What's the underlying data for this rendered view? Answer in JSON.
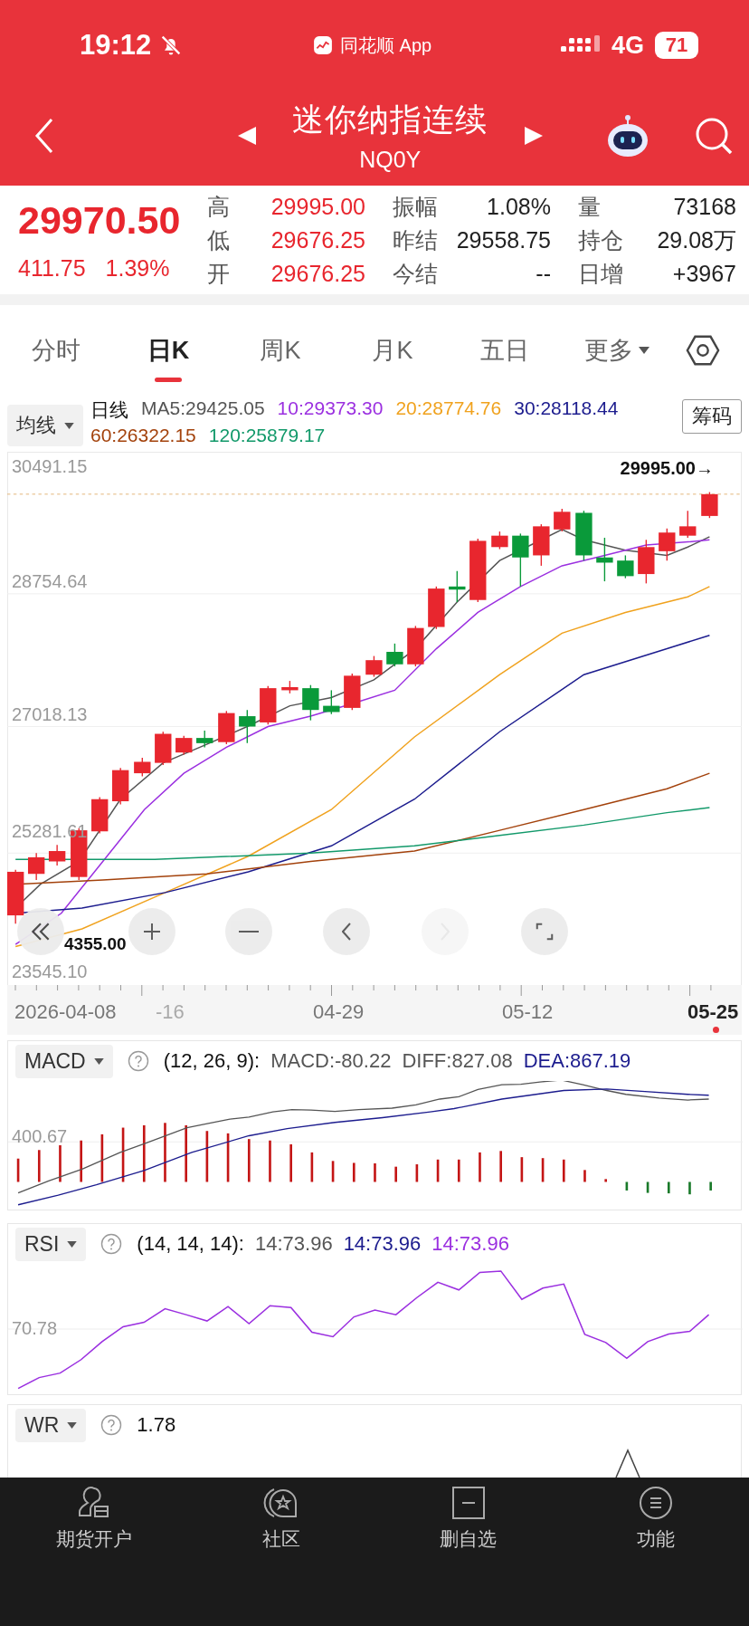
{
  "status_bar": {
    "time": "19:12",
    "app": "同花顺 App",
    "network": "4G",
    "battery": "71"
  },
  "header": {
    "title": "迷你纳指连续",
    "code": "NQ0Y"
  },
  "quote": {
    "price": "29970.50",
    "change": "411.75",
    "change_pct": "1.39%",
    "color": "#e8262e"
  },
  "stats": [
    {
      "label": "高",
      "value": "29995.00",
      "color": "#e8262e"
    },
    {
      "label": "振幅",
      "value": "1.08%",
      "color": "#222222"
    },
    {
      "label": "量",
      "value": "73168",
      "color": "#222222"
    },
    {
      "label": "低",
      "value": "29676.25",
      "color": "#e8262e"
    },
    {
      "label": "昨结",
      "value": "29558.75",
      "color": "#222222"
    },
    {
      "label": "持仓",
      "value": "29.08万",
      "color": "#222222"
    },
    {
      "label": "开",
      "value": "29676.25",
      "color": "#e8262e"
    },
    {
      "label": "今结",
      "value": "--",
      "color": "#222222"
    },
    {
      "label": "日增",
      "value": "+3967",
      "color": "#222222"
    }
  ],
  "tabs": [
    {
      "label": "分时",
      "selected": false,
      "kind": "period"
    },
    {
      "label": "日K",
      "selected": true,
      "kind": "period"
    },
    {
      "label": "周K",
      "selected": false,
      "kind": "period"
    },
    {
      "label": "月K",
      "selected": false,
      "kind": "period"
    },
    {
      "label": "五日",
      "selected": false,
      "kind": "period"
    },
    {
      "label": "更多",
      "selected": false,
      "kind": "menu"
    }
  ],
  "ma_legend": {
    "selector": "均线",
    "period": "日线",
    "button": "筹码",
    "series": [
      {
        "label": "MA5:29425.05",
        "color": "#555555"
      },
      {
        "label": "10:29373.30",
        "color": "#9b30e0"
      },
      {
        "label": "20:28774.76",
        "color": "#f0a21e"
      },
      {
        "label": "30:28118.44",
        "color": "#1c1c8e"
      },
      {
        "label": "60:26322.15",
        "color": "#a3420c"
      },
      {
        "label": "120:25879.17",
        "color": "#12996a"
      }
    ]
  },
  "chart": {
    "y_labels": [
      "30491.15",
      "28754.64",
      "27018.13",
      "25281.61",
      "23545.10"
    ],
    "high_marker": "29995.00→",
    "low_marker": "4355.00",
    "controls": [
      {
        "kind": "rewind",
        "disabled": false
      },
      {
        "kind": "zoom-in",
        "disabled": false
      },
      {
        "kind": "zoom-out",
        "disabled": false
      },
      {
        "kind": "previous",
        "disabled": false
      },
      {
        "kind": "next",
        "disabled": true
      },
      {
        "kind": "fullscreen",
        "disabled": false
      }
    ]
  },
  "date_axis": [
    {
      "label": "2026-04-08",
      "color": "#777777",
      "current": false
    },
    {
      "label": "-16",
      "color": "#aaaaaa",
      "current": false
    },
    {
      "label": "04-29",
      "color": "#777777",
      "current": false
    },
    {
      "label": "05-12",
      "color": "#777777",
      "current": false
    },
    {
      "label": "05-25",
      "color": "#222222",
      "current": true
    }
  ],
  "macd": {
    "selector": "MACD",
    "params": "(12, 26, 9):",
    "y_label": "400.67",
    "values": [
      {
        "text": "MACD:-80.22",
        "color": "#555555"
      },
      {
        "text": "DIFF:827.08",
        "color": "#555555"
      },
      {
        "text": "DEA:867.19",
        "color": "#1c1c8e"
      }
    ]
  },
  "rsi": {
    "selector": "RSI",
    "params": "(14, 14, 14):",
    "y_label": "70.78",
    "values": [
      {
        "text": "14:73.96",
        "color": "#555555"
      },
      {
        "text": "14:73.96",
        "color": "#1c1c8e"
      },
      {
        "text": "14:73.96",
        "color": "#9b30e0"
      }
    ]
  },
  "wr": {
    "selector": "WR",
    "value": "1.78"
  },
  "bottom_nav": [
    {
      "label": "期货开户",
      "kind": "account"
    },
    {
      "label": "社区",
      "kind": "community"
    },
    {
      "label": "删自选",
      "kind": "remove"
    },
    {
      "label": "功能",
      "kind": "functions"
    }
  ]
}
